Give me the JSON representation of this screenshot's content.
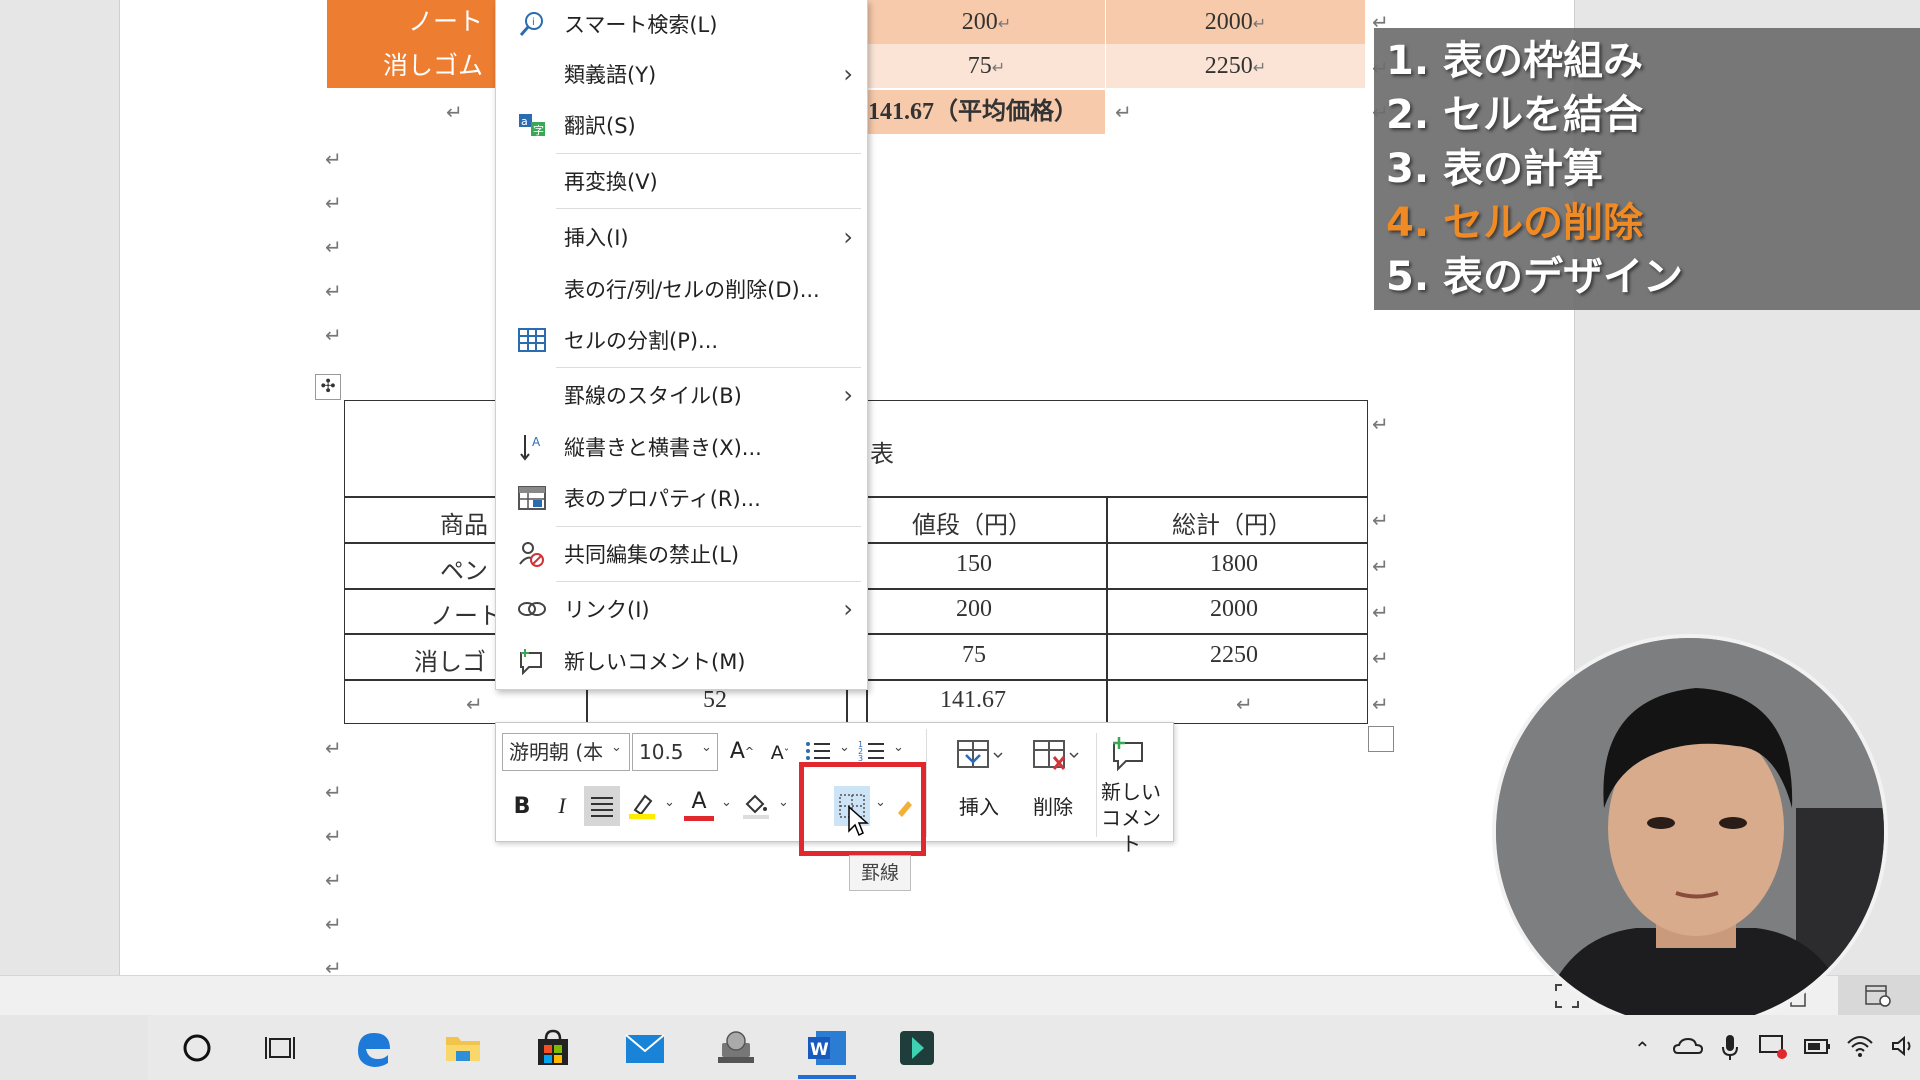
{
  "document": {
    "upper_table": {
      "rows": [
        {
          "item": "ノート",
          "price": "200",
          "total": "2000"
        },
        {
          "item": "消しゴム",
          "price": "75",
          "total": "2250"
        }
      ],
      "average_label": "141.67（平均価格）"
    },
    "lower_table": {
      "title_fragment": "表",
      "headers": {
        "item": "商品",
        "price": "値段（円）",
        "total": "総計（円）"
      },
      "rows": [
        {
          "item": "ペン",
          "price": "150",
          "total": "1800"
        },
        {
          "item": "ノート",
          "price": "200",
          "total": "2000"
        },
        {
          "item": "消しゴ",
          "price": "75",
          "total": "2250"
        }
      ],
      "summary": {
        "quantity": "52",
        "price": "141.67"
      }
    },
    "para_mark": "↵",
    "move_handle_glyph": "✣"
  },
  "context_menu": {
    "items": [
      {
        "label": "スマート検索(L)",
        "icon": "smart-search-icon"
      },
      {
        "label": "類義語(Y)",
        "icon": "",
        "submenu": true
      },
      {
        "label": "翻訳(S)",
        "icon": "translate-icon"
      },
      {
        "label": "再変換(V)",
        "icon": ""
      },
      {
        "label": "挿入(I)",
        "icon": "",
        "submenu": true
      },
      {
        "label": "表の行/列/セルの削除(D)...",
        "icon": ""
      },
      {
        "label": "セルの分割(P)...",
        "icon": "split-cells-icon"
      },
      {
        "label": "罫線のスタイル(B)",
        "icon": "",
        "submenu": true
      },
      {
        "label": "縦書きと横書き(X)...",
        "icon": "text-direction-icon"
      },
      {
        "label": "表のプロパティ(R)...",
        "icon": "table-properties-icon"
      },
      {
        "label": "共同編集の禁止(L)",
        "icon": "block-authors-icon"
      },
      {
        "label": "リンク(I)",
        "icon": "link-icon",
        "submenu": true
      },
      {
        "label": "新しいコメント(M)",
        "icon": "new-comment-icon"
      }
    ],
    "submenu_glyph": "›"
  },
  "mini_toolbar": {
    "font_name": "游明朝 (本",
    "font_size": "10.5",
    "grow_font": "A",
    "shrink_font": "A",
    "bold": "B",
    "italic": "I",
    "font_color_glyph": "A",
    "insert_label": "挿入",
    "delete_label": "削除",
    "new_comment_label_1": "新しい",
    "new_comment_label_2": "コメント",
    "tooltip": "罫線",
    "caret": "⌄"
  },
  "chapters": [
    {
      "label": "1. 表の枠組み",
      "active": false
    },
    {
      "label": "2. セルを結合",
      "active": false
    },
    {
      "label": "3. 表の計算",
      "active": false
    },
    {
      "label": "4. セルの削除",
      "active": true
    },
    {
      "label": "5. 表のデザイン",
      "active": false
    }
  ],
  "colors": {
    "header_orange": "#ed7d31",
    "peach": "#fbe4d5",
    "highlight_red": "#e0282e",
    "chapter_active": "#f08a24"
  },
  "taskbar": {
    "icons": [
      "cortana-circle-icon",
      "task-view-icon",
      "edge-icon",
      "file-explorer-icon",
      "store-icon",
      "mail-icon",
      "network-drive-icon",
      "word-icon",
      "filmora-icon"
    ],
    "word_letter": "W"
  }
}
